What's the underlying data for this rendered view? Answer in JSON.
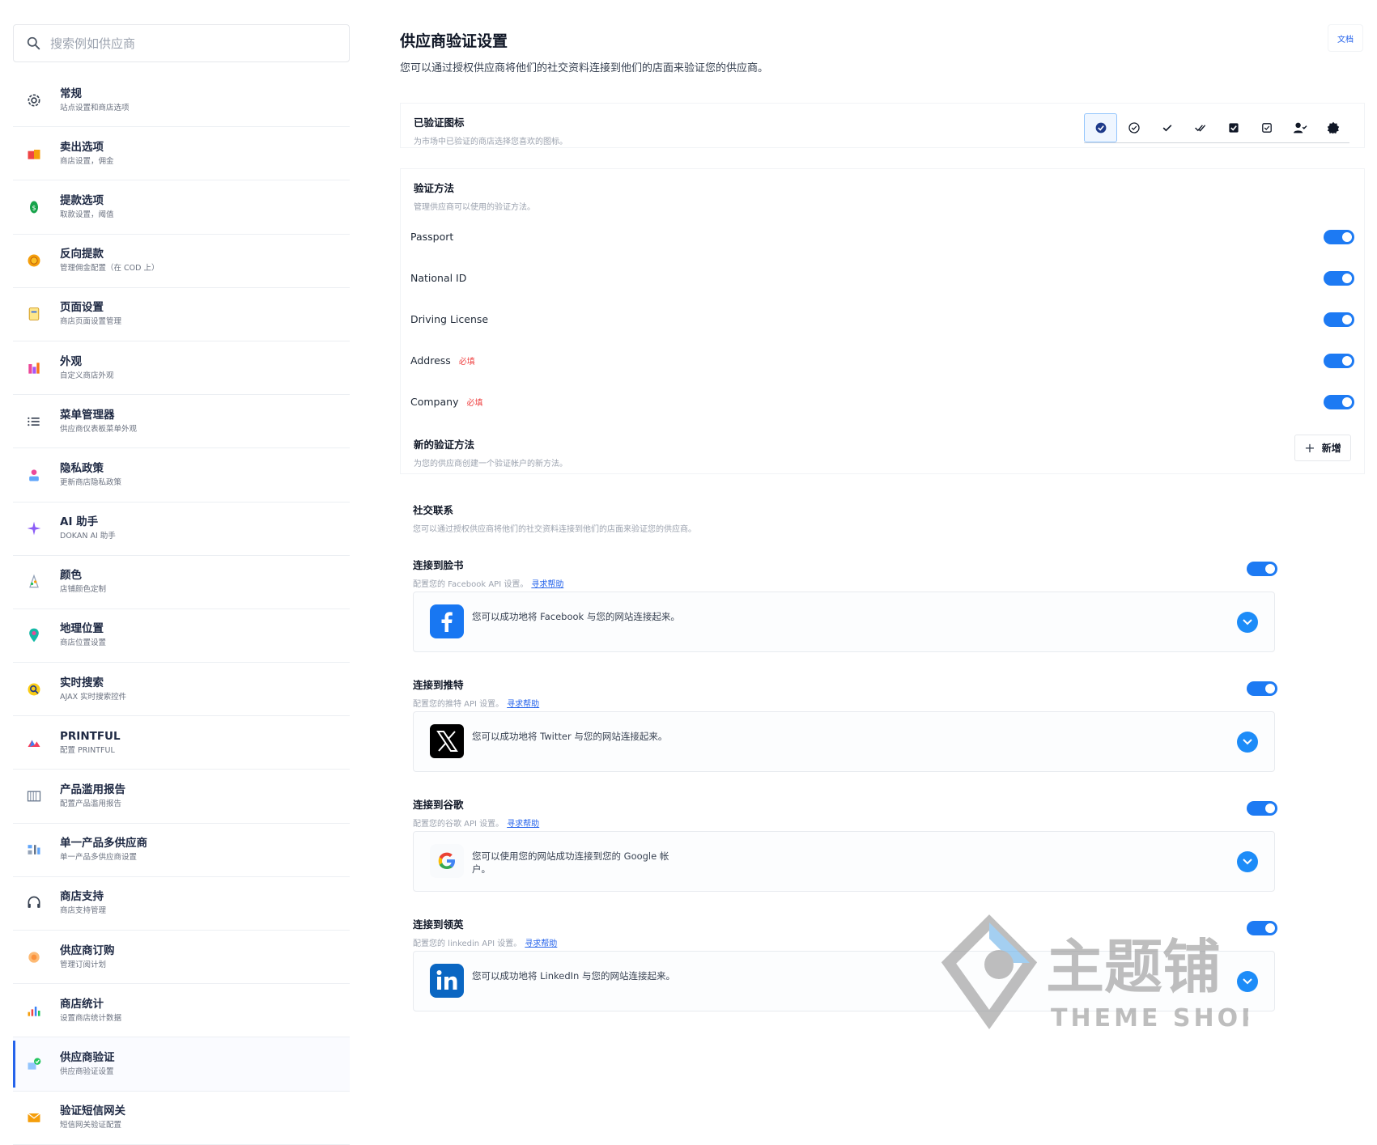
{
  "search": {
    "placeholder": "搜索例如供应商"
  },
  "sidebar": {
    "items": [
      {
        "title": "常规",
        "sub": "站点设置和商店选项",
        "icon": "gear-icon"
      },
      {
        "title": "卖出选项",
        "sub": "商店设置，佣金",
        "icon": "store-icon"
      },
      {
        "title": "提款选项",
        "sub": "取款设置，阈值",
        "icon": "money-icon"
      },
      {
        "title": "反向提款",
        "sub": "管理佣金配置（在 COD 上）",
        "icon": "coin-icon"
      },
      {
        "title": "页面设置",
        "sub": "商店页面设置管理",
        "icon": "page-icon"
      },
      {
        "title": "外观",
        "sub": "自定义商店外观",
        "icon": "palette-icon"
      },
      {
        "title": "菜单管理器",
        "sub": "供应商仪表板菜单外观",
        "icon": "list-icon"
      },
      {
        "title": "隐私政策",
        "sub": "更新商店隐私政策",
        "icon": "privacy-icon"
      },
      {
        "title": "AI 助手",
        "sub": "DOKAN AI 助手",
        "icon": "sparkle-icon"
      },
      {
        "title": "颜色",
        "sub": "店铺颜色定制",
        "icon": "color-icon"
      },
      {
        "title": "地理位置",
        "sub": "商店位置设置",
        "icon": "location-icon"
      },
      {
        "title": "实时搜索",
        "sub": "AJAX 实时搜索控件",
        "icon": "live-search-icon"
      },
      {
        "title": "PRINTFUL",
        "sub": "配置 PRINTFUL",
        "icon": "printful-icon"
      },
      {
        "title": "产品滥用报告",
        "sub": "配置产品滥用报告",
        "icon": "report-icon"
      },
      {
        "title": "单一产品多供应商",
        "sub": "单一产品多供应商设置",
        "icon": "multi-vendor-icon"
      },
      {
        "title": "商店支持",
        "sub": "商店支持管理",
        "icon": "headset-icon"
      },
      {
        "title": "供应商订购",
        "sub": "管理订阅计划",
        "icon": "subscription-icon"
      },
      {
        "title": "商店统计",
        "sub": "设置商店统计数据",
        "icon": "stats-icon"
      },
      {
        "title": "供应商验证",
        "sub": "供应商验证设置",
        "icon": "verify-icon"
      },
      {
        "title": "验证短信网关",
        "sub": "短信网关验证配置",
        "icon": "sms-icon"
      }
    ]
  },
  "header": {
    "title": "供应商验证设置",
    "desc": "您可以通过授权供应商将他们的社交资料连接到他们的店面来验证您的供应商。",
    "doc_label": "文档"
  },
  "verified_icon": {
    "title": "已验证图标",
    "sub": "为市场中已验证的商店选择您喜欢的图标。",
    "options": [
      "check-circle-solid-icon",
      "check-circle-outline-icon",
      "check-icon",
      "double-check-icon",
      "check-square-solid-icon",
      "check-square-outline-icon",
      "user-check-icon",
      "badge-icon"
    ],
    "selected_index": 0
  },
  "methods": {
    "title": "验证方法",
    "sub": "管理供应商可以使用的验证方法。",
    "required_label": "必填",
    "items": [
      {
        "label": "Passport",
        "required": false,
        "enabled": true
      },
      {
        "label": "National ID",
        "required": false,
        "enabled": true
      },
      {
        "label": "Driving License",
        "required": false,
        "enabled": true
      },
      {
        "label": "Address",
        "required": true,
        "enabled": true
      },
      {
        "label": "Company",
        "required": true,
        "enabled": true
      }
    ],
    "new_title": "新的验证方法",
    "new_sub": "为您的供应商创建一个验证帐户的新方法。",
    "add_label": "新增"
  },
  "social": {
    "title": "社交联系",
    "sub": "您可以通过授权供应商将他们的社交资料连接到他们的店面来验证您的供应商。",
    "help_label": "寻求帮助",
    "items": [
      {
        "title": "连接到脸书",
        "sub": "配置您的 Facebook API 设置。",
        "text": "您可以成功地将 Facebook 与您的网站连接起来。",
        "icon": "facebook-icon",
        "enabled": true
      },
      {
        "title": "连接到推特",
        "sub": "配置您的推特 API 设置。",
        "text": "您可以成功地将 Twitter 与您的网站连接起来。",
        "icon": "x-twitter-icon",
        "enabled": true
      },
      {
        "title": "连接到谷歌",
        "sub": "配置您的谷歌 API 设置。",
        "text": "您可以使用您的网站成功连接到您的 Google 帐户。",
        "icon": "google-icon",
        "enabled": true
      },
      {
        "title": "连接到领英",
        "sub": "配置您的 linkedin API 设置。",
        "text": "您可以成功地将 LinkedIn 与您的网站连接起来。",
        "icon": "linkedin-icon",
        "enabled": true
      }
    ]
  },
  "watermark": {
    "text_cn": "主题铺",
    "text_en": "THEME SHOP"
  },
  "colors": {
    "accent": "#1d7af3",
    "required": "#ef4444",
    "active_bar": "#2563eb"
  }
}
